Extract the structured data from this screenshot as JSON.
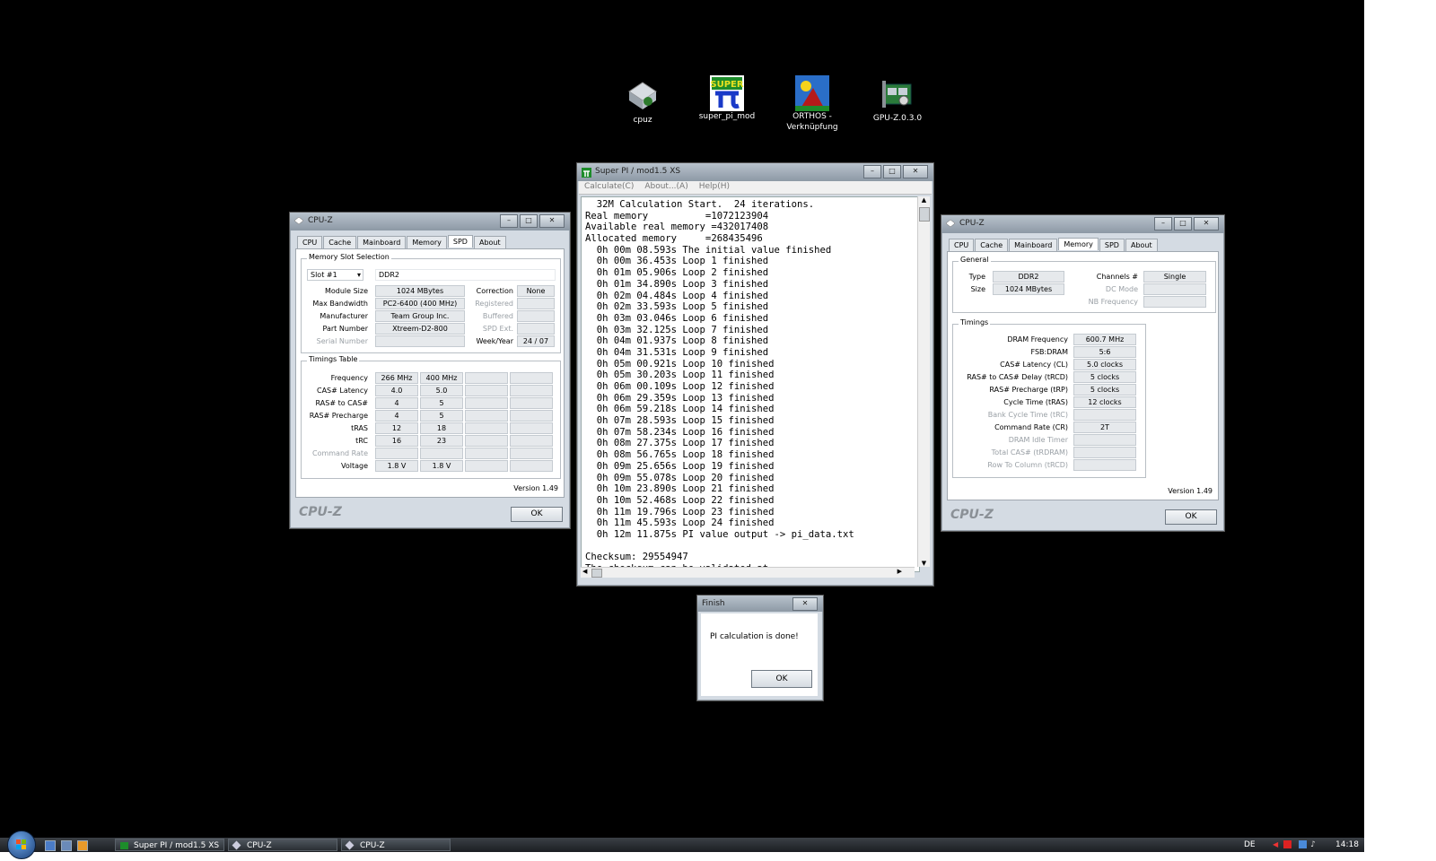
{
  "desktop_icons": [
    {
      "label": "cpuz",
      "icon": "cpuz-icon"
    },
    {
      "label": "super_pi_mod",
      "icon": "super-pi-icon"
    },
    {
      "label": "ORTHOS - Verknüpfung",
      "icon": "orthos-icon"
    },
    {
      "label": "GPU-Z.0.3.0",
      "icon": "gpuz-icon"
    }
  ],
  "cpuz_left": {
    "title": "CPU-Z",
    "tabs": [
      "CPU",
      "Cache",
      "Mainboard",
      "Memory",
      "SPD",
      "About"
    ],
    "active_tab": "SPD",
    "slot_group": "Memory Slot Selection",
    "slot_select": "Slot #1",
    "slot_type": "DDR2",
    "module_size_label": "Module Size",
    "module_size": "1024 MBytes",
    "max_bandwidth_label": "Max Bandwidth",
    "max_bandwidth": "PC2-6400 (400 MHz)",
    "manufacturer_label": "Manufacturer",
    "manufacturer": "Team Group Inc.",
    "part_number_label": "Part Number",
    "part_number": "Xtreem-D2-800",
    "serial_number_label": "Serial Number",
    "correction_label": "Correction",
    "correction": "None",
    "registered_label": "Registered",
    "buffered_label": "Buffered",
    "spd_ext_label": "SPD Ext.",
    "week_year_label": "Week/Year",
    "week_year": "24 / 07",
    "timings_group": "Timings Table",
    "timing_rows": [
      {
        "label": "Frequency",
        "v1": "266 MHz",
        "v2": "400 MHz"
      },
      {
        "label": "CAS# Latency",
        "v1": "4.0",
        "v2": "5.0"
      },
      {
        "label": "RAS# to CAS#",
        "v1": "4",
        "v2": "5"
      },
      {
        "label": "RAS# Precharge",
        "v1": "4",
        "v2": "5"
      },
      {
        "label": "tRAS",
        "v1": "12",
        "v2": "18"
      },
      {
        "label": "tRC",
        "v1": "16",
        "v2": "23"
      },
      {
        "label": "Command Rate",
        "v1": "",
        "v2": ""
      },
      {
        "label": "Voltage",
        "v1": "1.8 V",
        "v2": "1.8 V"
      }
    ],
    "version": "Version 1.49",
    "brand": "CPU-Z",
    "ok": "OK"
  },
  "superpi": {
    "title": "Super PI / mod1.5 XS",
    "menu": [
      "Calculate(C)",
      "About...(A)",
      "Help(H)"
    ],
    "lines": [
      "  32M Calculation Start.  24 iterations.",
      "Real memory          =1072123904",
      "Available real memory =432017408",
      "Allocated memory     =268435496",
      "  0h 00m 08.593s The initial value finished",
      "  0h 00m 36.453s Loop 1 finished",
      "  0h 01m 05.906s Loop 2 finished",
      "  0h 01m 34.890s Loop 3 finished",
      "  0h 02m 04.484s Loop 4 finished",
      "  0h 02m 33.593s Loop 5 finished",
      "  0h 03m 03.046s Loop 6 finished",
      "  0h 03m 32.125s Loop 7 finished",
      "  0h 04m 01.937s Loop 8 finished",
      "  0h 04m 31.531s Loop 9 finished",
      "  0h 05m 00.921s Loop 10 finished",
      "  0h 05m 30.203s Loop 11 finished",
      "  0h 06m 00.109s Loop 12 finished",
      "  0h 06m 29.359s Loop 13 finished",
      "  0h 06m 59.218s Loop 14 finished",
      "  0h 07m 28.593s Loop 15 finished",
      "  0h 07m 58.234s Loop 16 finished",
      "  0h 08m 27.375s Loop 17 finished",
      "  0h 08m 56.765s Loop 18 finished",
      "  0h 09m 25.656s Loop 19 finished",
      "  0h 09m 55.078s Loop 20 finished",
      "  0h 10m 23.890s Loop 21 finished",
      "  0h 10m 52.468s Loop 22 finished",
      "  0h 11m 19.796s Loop 23 finished",
      "  0h 11m 45.593s Loop 24 finished",
      "  0h 12m 11.875s PI value output -> pi_data.txt",
      "",
      "Checksum: 29554947",
      "The checksum can be validated at"
    ]
  },
  "finish_dialog": {
    "title": "Finish",
    "message": "PI calculation is done!",
    "ok": "OK"
  },
  "cpuz_right": {
    "title": "CPU-Z",
    "tabs": [
      "CPU",
      "Cache",
      "Mainboard",
      "Memory",
      "SPD",
      "About"
    ],
    "active_tab": "Memory",
    "general_group": "General",
    "type_label": "Type",
    "type": "DDR2",
    "size_label": "Size",
    "size": "1024 MBytes",
    "channels_label": "Channels #",
    "channels": "Single",
    "dc_mode_label": "DC Mode",
    "nb_freq_label": "NB Frequency",
    "timings_group": "Timings",
    "timings": [
      {
        "label": "DRAM Frequency",
        "value": "600.7 MHz",
        "disabled": false
      },
      {
        "label": "FSB:DRAM",
        "value": "5:6",
        "disabled": false
      },
      {
        "label": "CAS# Latency (CL)",
        "value": "5.0 clocks",
        "disabled": false
      },
      {
        "label": "RAS# to CAS# Delay (tRCD)",
        "value": "5 clocks",
        "disabled": false
      },
      {
        "label": "RAS# Precharge (tRP)",
        "value": "5 clocks",
        "disabled": false
      },
      {
        "label": "Cycle Time (tRAS)",
        "value": "12 clocks",
        "disabled": false
      },
      {
        "label": "Bank Cycle Time (tRC)",
        "value": "",
        "disabled": true
      },
      {
        "label": "Command Rate (CR)",
        "value": "2T",
        "disabled": false
      },
      {
        "label": "DRAM Idle Timer",
        "value": "",
        "disabled": true
      },
      {
        "label": "Total CAS# (tRDRAM)",
        "value": "",
        "disabled": true
      },
      {
        "label": "Row To Column (tRCD)",
        "value": "",
        "disabled": true
      }
    ],
    "version": "Version 1.49",
    "brand": "CPU-Z",
    "ok": "OK"
  },
  "taskbar": {
    "buttons": [
      {
        "label": "Super PI / mod1.5 XS",
        "icon": "superpi-task-icon"
      },
      {
        "label": "CPU-Z",
        "icon": "cpuz-task-icon"
      },
      {
        "label": "CPU-Z",
        "icon": "cpuz-task-icon"
      }
    ],
    "language": "DE",
    "clock": "14:18"
  },
  "colors": {
    "desktop": "#000000",
    "window_chrome": "#d4dbe3",
    "taskbar": "#2a2f34"
  }
}
